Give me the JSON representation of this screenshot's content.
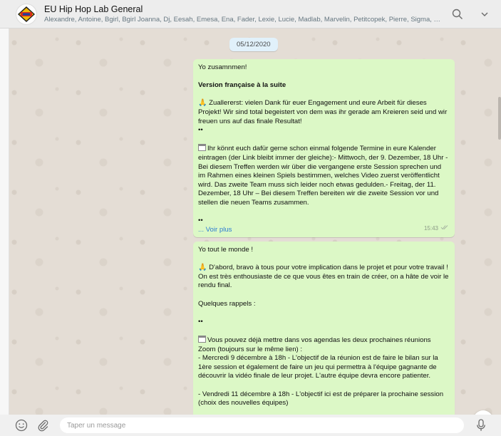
{
  "header": {
    "title": "EU Hip Hop Lab General",
    "participants": "Alexandre, Antoine, Bgirl, Bgirl Joanna, Dj, Eesah, Emesa, Ena, Fader, Lexie, Lucie, Madlab, Marvelin, Petitcopek, Pierre, Sigma, Sully, Tamay ...",
    "icons": [
      "group-logo",
      "search-icon",
      "chevron-down-icon"
    ]
  },
  "chat": {
    "date": "05/12/2020",
    "message1": {
      "greeting": "Yo zusamnmen!",
      "heading": "Version française à la suite",
      "para1": "Zuallererst: vielen Dank für euer Engagement und eure Arbeit für dieses Projekt! Wir sind total begeistert von dem was ihr gerade am Kreieren seid und wir freuen uns auf das finale Resultat!",
      "dots1": "••",
      "para2": "Ihr könnt euch dafür gerne schon einmal folgende Termine in eure Kalender eintragen (der Link bleibt immer der gleiche):- Mittwoch, der 9. Dezember, 18 Uhr - Bei diesem Treffen werden wir über die vergangene erste Session sprechen und im Rahmen eines kleinen Spiels bestimmen, welches Video zuerst veröffentlicht wird. Das zweite Team muss sich leider noch etwas gedulden.- Freitag, der 11. Dezember, 18 Uhr – Bei diesem Treffen bereiten wir die zweite Session vor und stellen die neuen Teams zusammen.",
      "dots2": "••",
      "read_more": "... Voir plus",
      "time": "15:43"
    },
    "message2": {
      "greeting": "Yo tout le monde !",
      "para1": "D'abord, bravo à tous pour votre implication dans le projet et pour votre travail ! On est très enthousiaste de ce que vous êtes en train de créer, on a hâte de voir le rendu final.",
      "para2": "Quelques rappels :",
      "dots1": "••",
      "para3": "Vous pouvez déjà mettre dans vos agendas les deux prochaines réunions Zoom (toujours sur le même lien) :",
      "para4": "- Mercredi 9 décembre à 18h - L'objectif de la réunion est de faire le bilan sur la 1ère session et également de faire un jeu qui permettra à l'équipe gagnante de découvrir la vidéo finale de leur projet. L'autre équipe devra encore patienter.",
      "para5": "- Vendredi 11 décembre à 18h - L'objectif ici est de préparer la prochaine session (choix des nouvelles équipes)"
    }
  },
  "footer": {
    "placeholder": "Taper un message",
    "icons": [
      "emoji-icon",
      "paperclip-icon",
      "microphone-icon"
    ]
  }
}
